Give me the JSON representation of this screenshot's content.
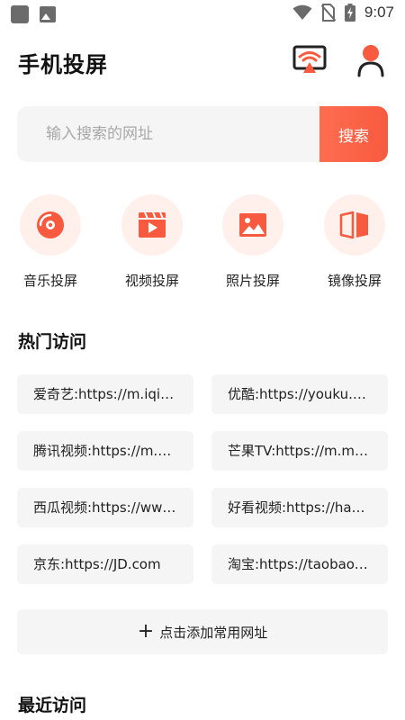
{
  "status_bar": {
    "time": "9:07"
  },
  "header": {
    "title": "手机投屏"
  },
  "search": {
    "placeholder": "输入搜索的网址",
    "button_label": "搜索"
  },
  "features": [
    {
      "label": "音乐投屏",
      "icon": "music-disc-icon"
    },
    {
      "label": "视频投屏",
      "icon": "video-play-icon"
    },
    {
      "label": "照片投屏",
      "icon": "photo-icon"
    },
    {
      "label": "镜像投屏",
      "icon": "mirror-icon"
    }
  ],
  "hot_section": {
    "title": "热门访问",
    "sites": [
      "爱奇艺:https://m.iqiyi.com",
      "优酷:https://youku.com",
      "腾讯视频:https://m.v.qq.com",
      "芒果TV:https://m.mgtv.com",
      "西瓜视频:https://www.ixigua.com",
      "好看视频:https://haokan.baidu.com",
      "京东:https://JD.com",
      "淘宝:https://taobao.com"
    ],
    "add_label": "点击添加常用网址"
  },
  "recent_section": {
    "title": "最近访问"
  },
  "colors": {
    "accent": "#f85a3f",
    "accent_light": "#fe6d50",
    "icon_bg": "#fff0ec",
    "card_bg": "#f5f5f5"
  }
}
